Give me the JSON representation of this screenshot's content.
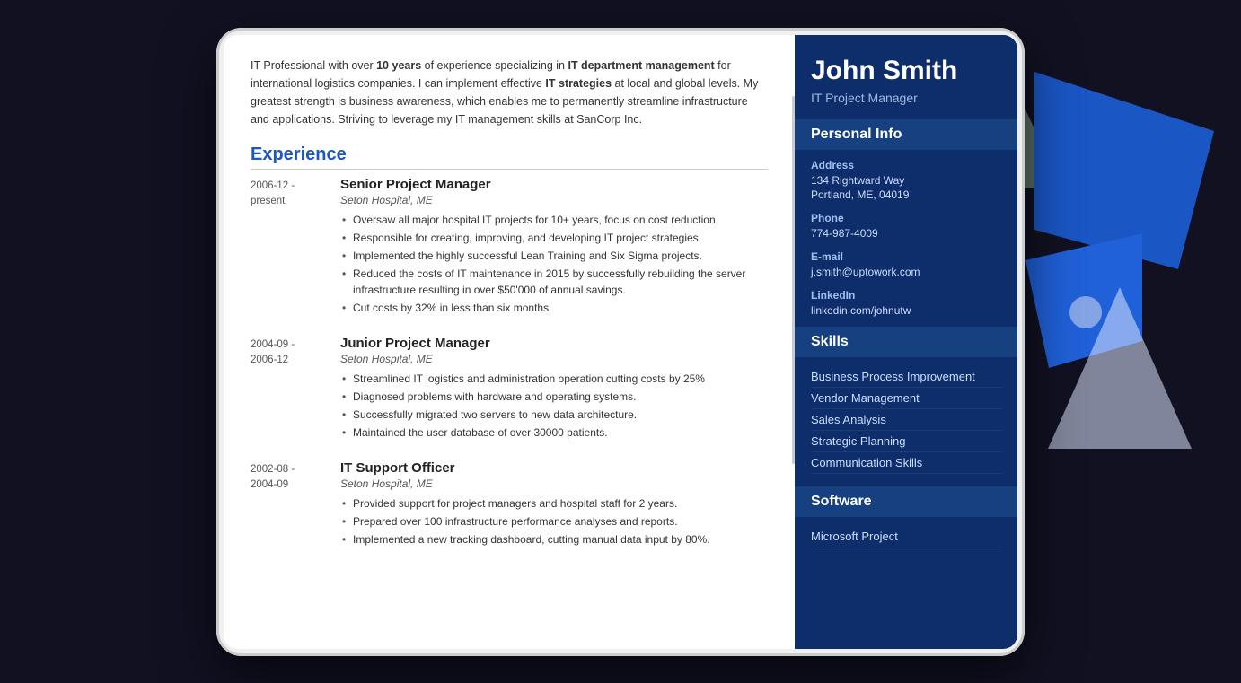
{
  "decorative": {
    "shapes": [
      "blue-large",
      "blue-small",
      "white-triangle",
      "green-triangle",
      "circle"
    ]
  },
  "resume": {
    "sidebar": {
      "name": "John Smith",
      "title": "IT Project Manager",
      "sections": {
        "personal_info": {
          "label": "Personal Info",
          "fields": {
            "address_label": "Address",
            "address_line1": "134 Rightward Way",
            "address_line2": "Portland, ME, 04019",
            "phone_label": "Phone",
            "phone_value": "774-987-4009",
            "email_label": "E-mail",
            "email_value": "j.smith@uptowork.com",
            "linkedin_label": "LinkedIn",
            "linkedin_value": "linkedin.com/johnutw"
          }
        },
        "skills": {
          "label": "Skills",
          "items": [
            "Business Process Improvement",
            "Vendor Management",
            "Sales Analysis",
            "Strategic Planning",
            "Communication Skills"
          ]
        },
        "software": {
          "label": "Software",
          "items": [
            "Microsoft Project"
          ]
        }
      }
    },
    "body": {
      "summary": "IT Professional with over {10 years} of experience specializing in {IT department management} for international logistics companies. I can implement effective {IT strategies} at local and global levels. My greatest strength is business awareness, which enables me to permanently streamline infrastructure and applications. Striving to leverage my IT management skills at SanCorp Inc.",
      "experience_title": "Experience",
      "jobs": [
        {
          "date_from": "2006-12 -",
          "date_to": "present",
          "title": "Senior Project Manager",
          "company": "Seton Hospital, ME",
          "bullets": [
            "Oversaw all major hospital IT projects for 10+ years, focus on cost reduction.",
            "Responsible for creating, improving, and developing IT project strategies.",
            "Implemented the highly successful Lean Training and Six Sigma projects.",
            "Reduced the costs of IT maintenance in 2015 by successfully rebuilding the server infrastructure resulting in over $50'000 of annual savings.",
            "Cut costs by 32% in less than six months."
          ]
        },
        {
          "date_from": "2004-09 -",
          "date_to": "2006-12",
          "title": "Junior Project Manager",
          "company": "Seton Hospital, ME",
          "bullets": [
            "Streamlined IT logistics and administration operation cutting costs by 25%",
            "Diagnosed problems with hardware and operating systems.",
            "Successfully migrated two servers to new data architecture.",
            "Maintained the user database of over 30000 patients."
          ]
        },
        {
          "date_from": "2002-08 -",
          "date_to": "2004-09",
          "title": "IT Support Officer",
          "company": "Seton Hospital, ME",
          "bullets": [
            "Provided support for project managers and hospital staff for 2 years.",
            "Prepared over 100 infrastructure performance analyses and reports.",
            "Implemented a new tracking dashboard, cutting manual data input by 80%."
          ]
        }
      ]
    }
  }
}
